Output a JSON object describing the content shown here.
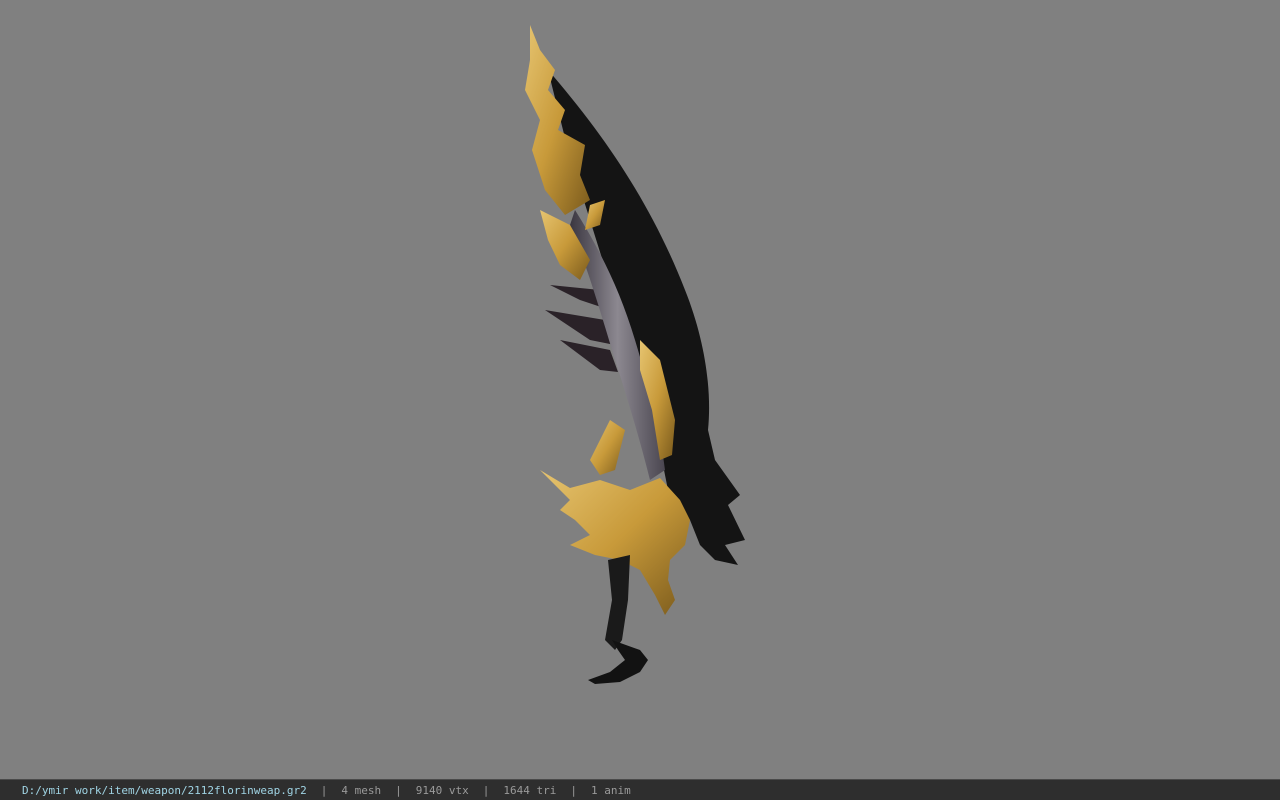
{
  "viewer": {
    "model_path": "D:/ymir work/item/weapon/2112florinweap.gr2",
    "separator": "|",
    "stats": [
      {
        "label": "4 mesh"
      },
      {
        "label": "9140 vtx"
      },
      {
        "label": "1644 tri"
      },
      {
        "label": "1 anim"
      }
    ]
  },
  "colors": {
    "background": "#808080",
    "statusbar": "#2e2e2e",
    "path_text": "#9fd3e3",
    "stat_text": "#9a9a9a"
  }
}
